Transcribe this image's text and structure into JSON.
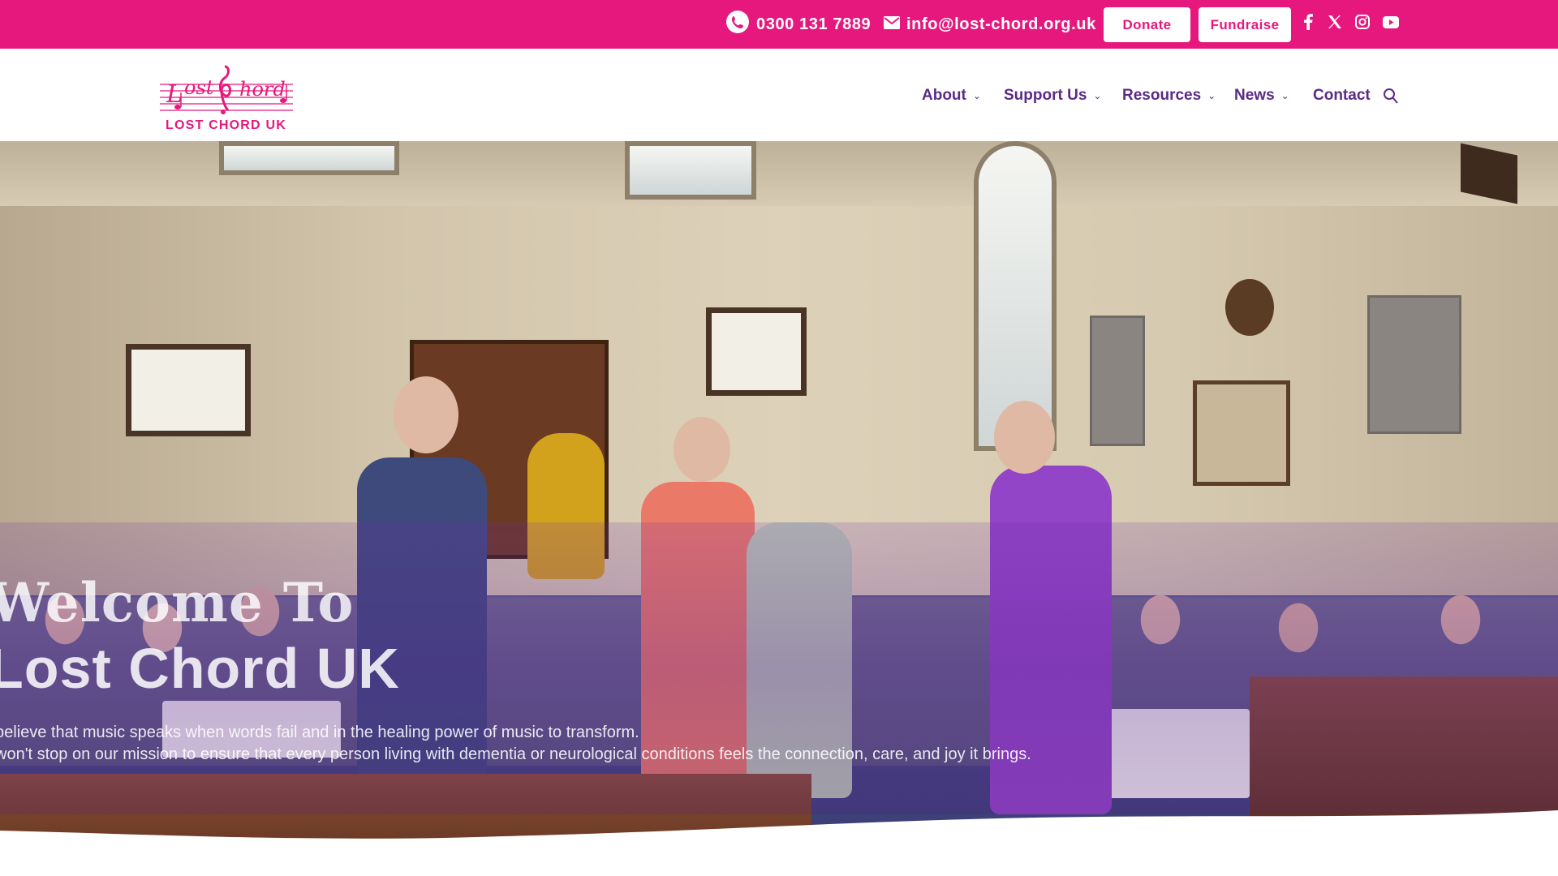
{
  "topbar": {
    "phone": "0300 131 7889",
    "email": "info@lost-chord.org.uk",
    "donate_label": "Donate",
    "fundraise_label": "Fundraise",
    "social_icons": [
      "facebook-icon",
      "x-icon",
      "instagram-icon",
      "youtube-icon"
    ],
    "bg_color": "#e6187e"
  },
  "header": {
    "logo_text": "LOST CHORD UK",
    "nav": [
      {
        "label": "About",
        "has_dropdown": true
      },
      {
        "label": "Support Us",
        "has_dropdown": true
      },
      {
        "label": "Resources",
        "has_dropdown": true
      },
      {
        "label": "News",
        "has_dropdown": true
      },
      {
        "label": "Contact",
        "has_dropdown": false
      }
    ],
    "nav_color": "#5b2a86",
    "search_icon": "search-icon"
  },
  "hero": {
    "welcome": "Welcome To",
    "title": "Lost Chord UK",
    "subtitle_line1": "believe that music speaks when words fail and in the healing power of music to transform.",
    "subtitle_line2": "won't stop on our mission to ensure that every person living with dementia or neurological conditions feels the connection, care, and joy it brings."
  }
}
